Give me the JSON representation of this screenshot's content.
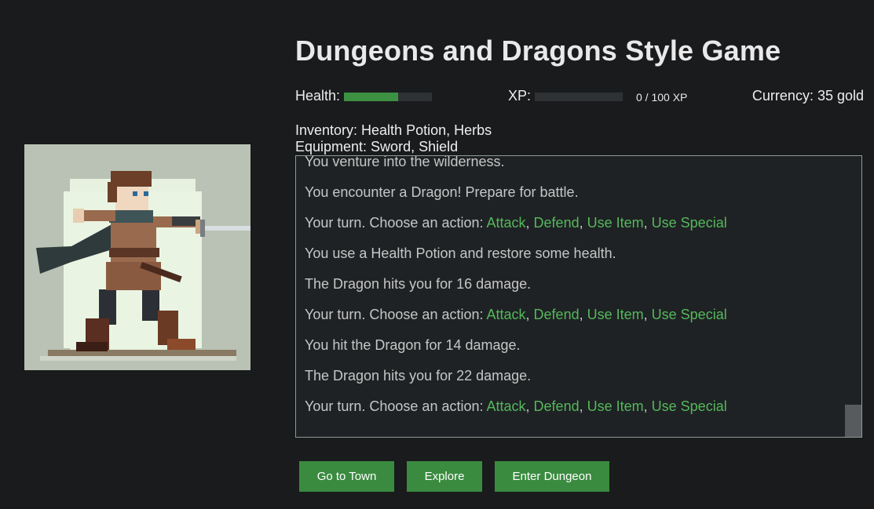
{
  "title": "Dungeons and Dragons Style Game",
  "stats": {
    "health_label": "Health:",
    "health_fraction": 0.62,
    "xp_label": "XP:",
    "xp_fraction": 0.0,
    "xp_text": "0 / 100 XP",
    "currency_text": "Currency: 35 gold"
  },
  "inventory_text": "Inventory: Health Potion, Herbs",
  "equipment_text": "Equipment: Sword, Shield",
  "log": [
    {
      "text": "You venture into the wilderness."
    },
    {
      "text": "You encounter a Dragon! Prepare for battle."
    },
    {
      "text": "Your turn. Choose an action: ",
      "actions": [
        "Attack",
        "Defend",
        "Use Item",
        "Use Special"
      ]
    },
    {
      "text": "You use a Health Potion and restore some health."
    },
    {
      "text": "The Dragon hits you for 16 damage."
    },
    {
      "text": "Your turn. Choose an action: ",
      "actions": [
        "Attack",
        "Defend",
        "Use Item",
        "Use Special"
      ]
    },
    {
      "text": "You hit the Dragon for 14 damage."
    },
    {
      "text": "The Dragon hits you for 22 damage."
    },
    {
      "text": "Your turn. Choose an action: ",
      "actions": [
        "Attack",
        "Defend",
        "Use Item",
        "Use Special"
      ]
    }
  ],
  "buttons": {
    "town": "Go to Town",
    "explore": "Explore",
    "dungeon": "Enter Dungeon"
  },
  "colors": {
    "background": "#1a1b1d",
    "accent_green": "#3d9142",
    "action_link": "#55b85c",
    "button_green": "#3a8b3f"
  },
  "portrait_icon": "pixel-art-swordsman"
}
